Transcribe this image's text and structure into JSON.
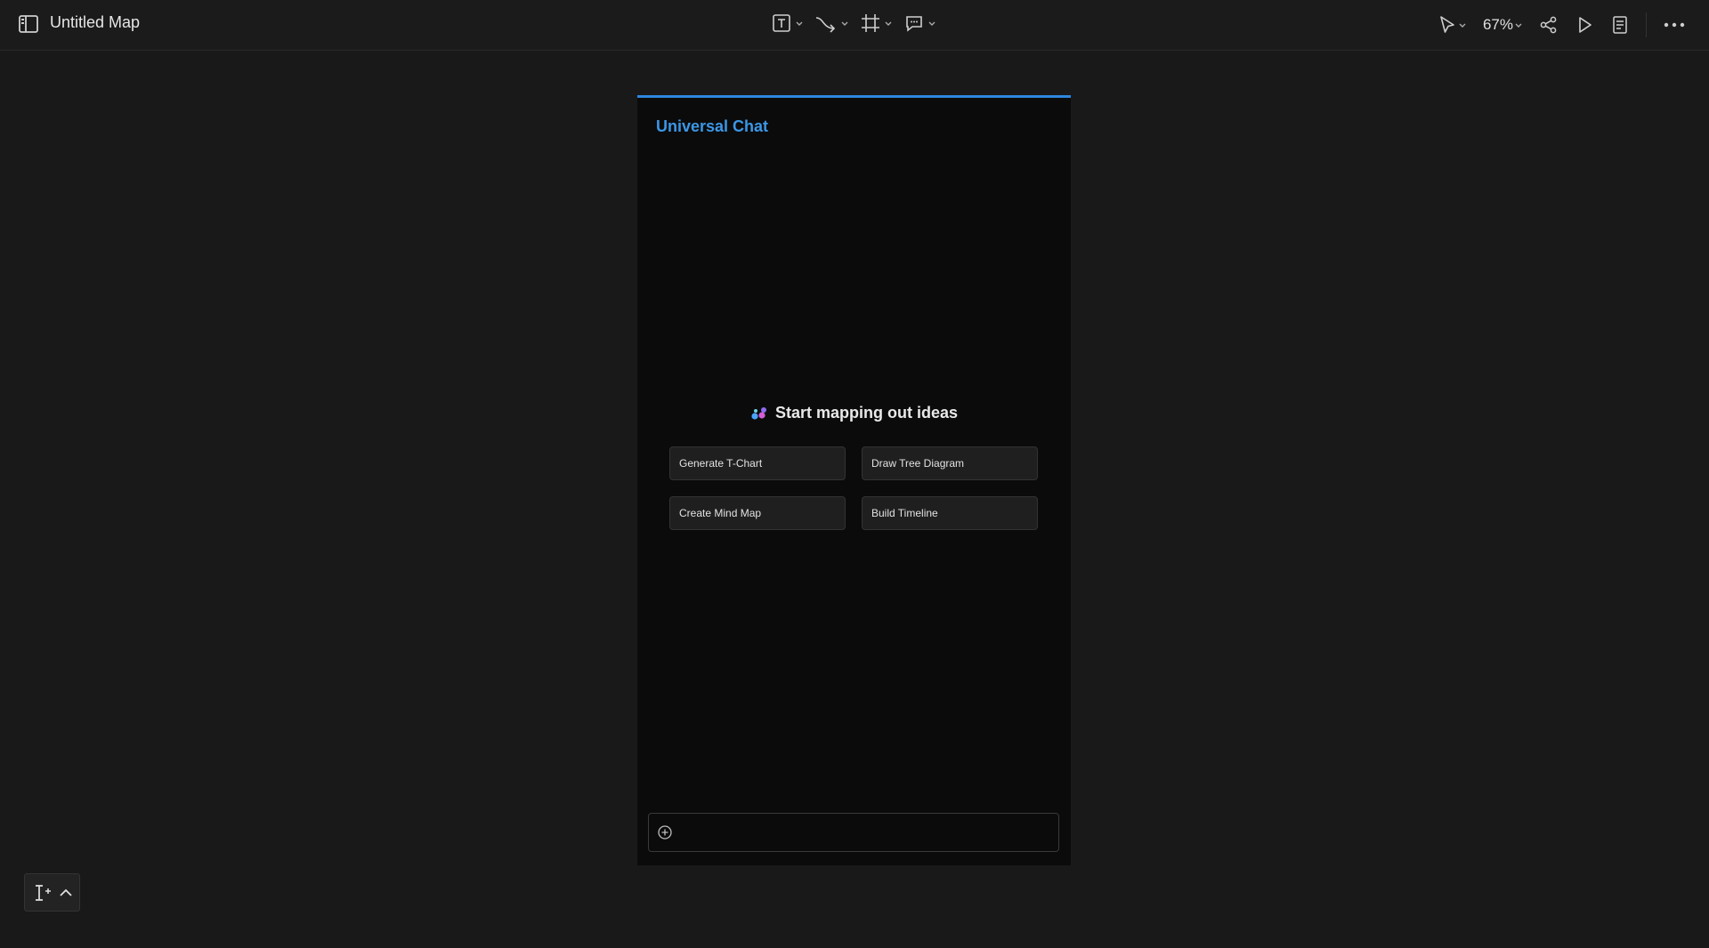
{
  "header": {
    "title": "Untitled Map",
    "zoom": "67%"
  },
  "toolbar": {
    "tools": [
      "text-tool",
      "connector-tool",
      "frame-tool",
      "comment-tool"
    ]
  },
  "right_toolbar": {
    "icons": [
      "pointer-icon",
      "share-icon",
      "play-icon",
      "notes-icon",
      "more-icon"
    ]
  },
  "chat_panel": {
    "title": "Universal Chat",
    "heading": "Start mapping out ideas",
    "suggestions": [
      "Generate T-Chart",
      "Draw Tree Diagram",
      "Create Mind Map",
      "Build Timeline"
    ],
    "input_value": ""
  },
  "colors": {
    "accent": "#2e86de",
    "panel_title": "#3b97e6",
    "background": "#191919",
    "panel_background": "#0b0b0b"
  }
}
